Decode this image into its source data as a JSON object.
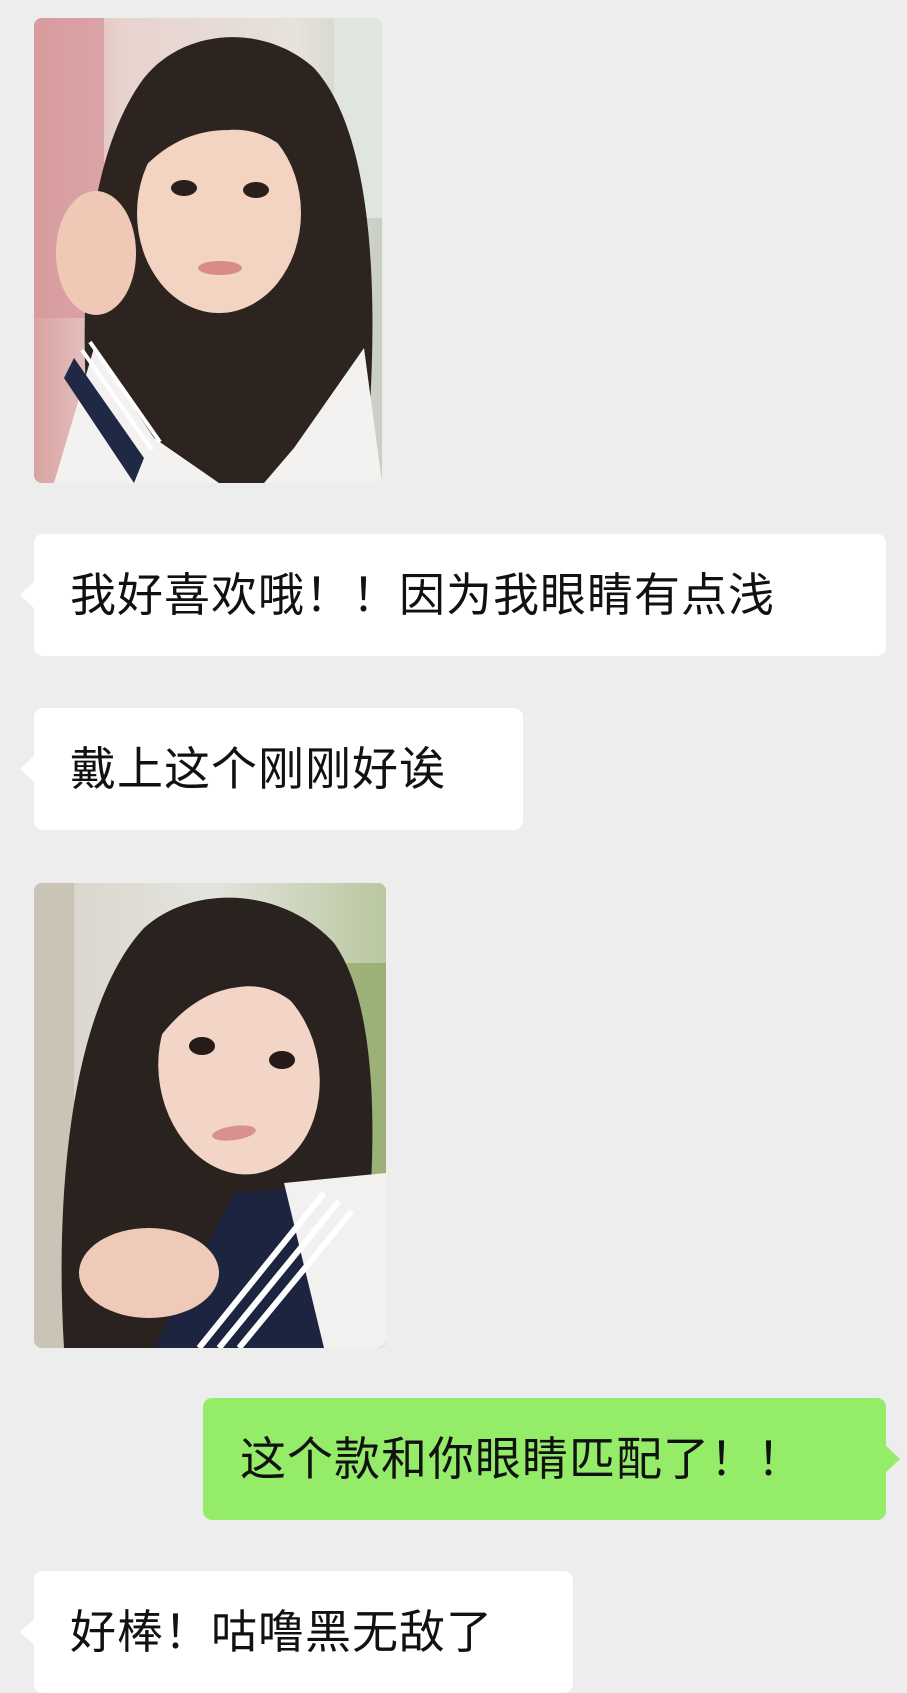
{
  "conversation": {
    "messages": [
      {
        "type": "image",
        "sender": "contact",
        "alt": ""
      },
      {
        "type": "text",
        "sender": "contact",
        "text": "我好喜欢哦！！因为我眼睛有点浅"
      },
      {
        "type": "text",
        "sender": "contact",
        "text": "戴上这个刚刚好诶"
      },
      {
        "type": "image",
        "sender": "contact",
        "alt": ""
      },
      {
        "type": "text",
        "sender": "me",
        "text": "这个款和你眼睛匹配了！！"
      },
      {
        "type": "text",
        "sender": "contact",
        "text": "好棒！咕噜黑无敌了"
      }
    ]
  },
  "colors": {
    "background": "#ededed",
    "incoming_bubble": "#ffffff",
    "outgoing_bubble": "#95ec69",
    "text": "#111111"
  }
}
